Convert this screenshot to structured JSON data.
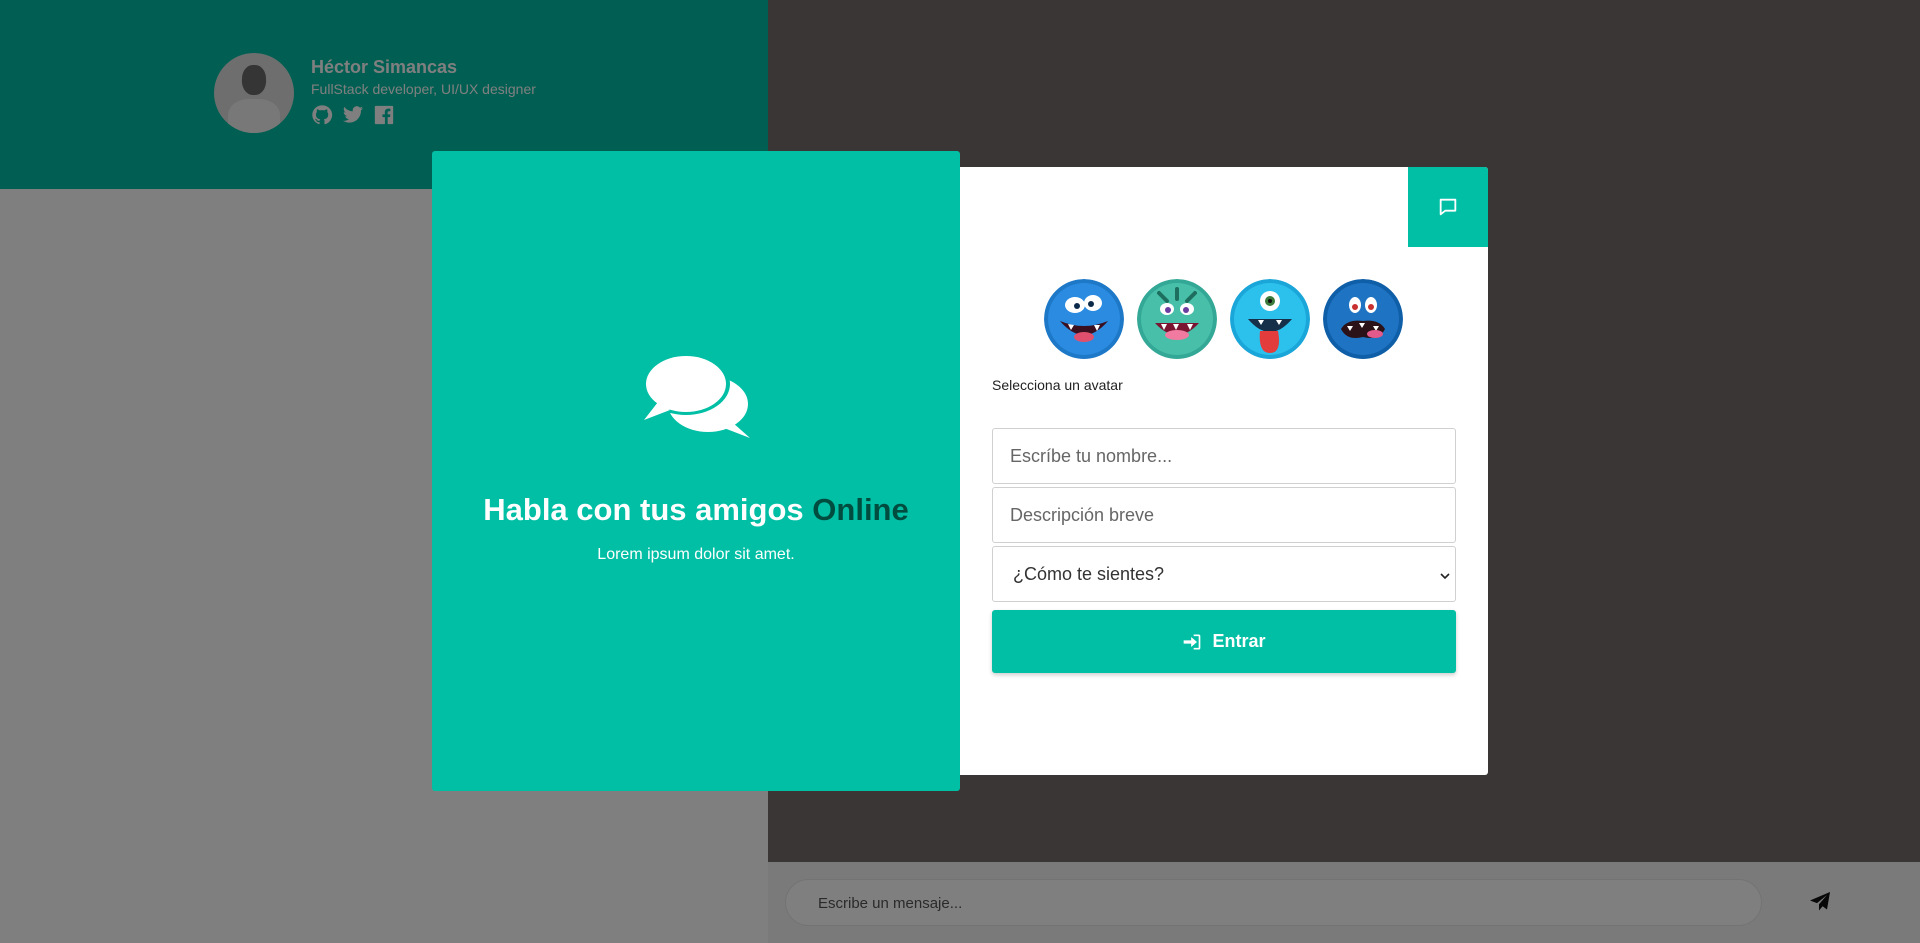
{
  "profile": {
    "name": "Héctor Simancas",
    "role": "FullStack developer, UI/UX designer",
    "social": [
      "github-icon",
      "twitter-icon",
      "facebook-icon"
    ]
  },
  "hero": {
    "title_main": "Habla con tus amigos",
    "title_accent": "Online",
    "subtitle": "Lorem ipsum dolor sit amet."
  },
  "form": {
    "avatars": [
      "avatar-blue-monster",
      "avatar-green-monster",
      "avatar-cyclops-monster",
      "avatar-scared-monster"
    ],
    "select_avatar_label": "Selecciona un avatar",
    "name_placeholder": "Escríbe tu nombre...",
    "description_placeholder": "Descripción breve",
    "mood_selected": "¿Cómo te sientes?",
    "submit_label": "Entrar"
  },
  "chat": {
    "message_placeholder": "Escribe un mensaje..."
  },
  "colors": {
    "accent": "#00bfa5",
    "accent_dark": "#004d40"
  }
}
